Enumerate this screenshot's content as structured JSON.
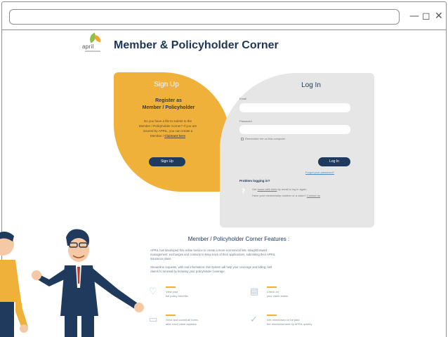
{
  "window": {
    "minimize_glyph": "—",
    "maximize_glyph": "◻",
    "close_glyph": "✕"
  },
  "logo": {
    "word": "april"
  },
  "page": {
    "title": "Member & Policyholder Corner"
  },
  "signup": {
    "title": "Sign Up",
    "subtitle_line1": "Register as",
    "subtitle_line2": "Member / Policyholder",
    "text_line1": "Do you have a file to submit to the",
    "text_line2": "Member / Policyholder Corner? If you are",
    "text_line3": "insured by APRIL, you can create a",
    "text_line4": "Member /",
    "text_link": "Claimant here",
    "button": "Sign Up"
  },
  "login": {
    "title": "Log In",
    "email_label": "Email",
    "password_label": "Password",
    "remember_label": "Remember me on this computer",
    "button": "Log In",
    "forgot_link": "Forgot your password?",
    "problems_title": "Problem logging in?",
    "problem_line1_prefix": "Get",
    "problem_line1_link": "home with hints",
    "problem_line1_suffix": "by email to log in again.",
    "problem_line2_prefix": "Have your membership number or a claim? ",
    "problem_line2_link": "Contact us"
  },
  "features": {
    "title": "Member / Policyholder Corner Features :",
    "para1_line1": "APRIL has developed this online service to create a more economical link, straightforward",
    "para1_line2": "management: exchanges and contacts to keep track of their applications, submitting their APRIL",
    "para1_line3": "insurance plans.",
    "para2_line1": "Streamline requests, with real information: this system will help your coverage and billing; fast",
    "para2_line2": "claims to renewal by knowing your policyholder coverage.",
    "items": [
      {
        "icon": "lightbulb-icon",
        "glyph": "♡",
        "line1": "View your",
        "line2": "full policy benefits"
      },
      {
        "icon": "document-icon",
        "glyph": "▤",
        "line1": "Check on",
        "line2": "your claim status"
      },
      {
        "icon": "folder-icon",
        "glyph": "▭",
        "line1": "Send and submit all forms",
        "line2": "after each claim appears"
      },
      {
        "icon": "check-circle-icon",
        "glyph": "✓",
        "line1": "Get reimbursed or be paid",
        "line2": "the reimbursement by APRIL quickly"
      }
    ]
  },
  "colors": {
    "brand_navy": "#1d3557",
    "accent_orange": "#f0b13a",
    "panel_grey": "#e6e6e6",
    "button_dark": "#1f3a5c"
  }
}
